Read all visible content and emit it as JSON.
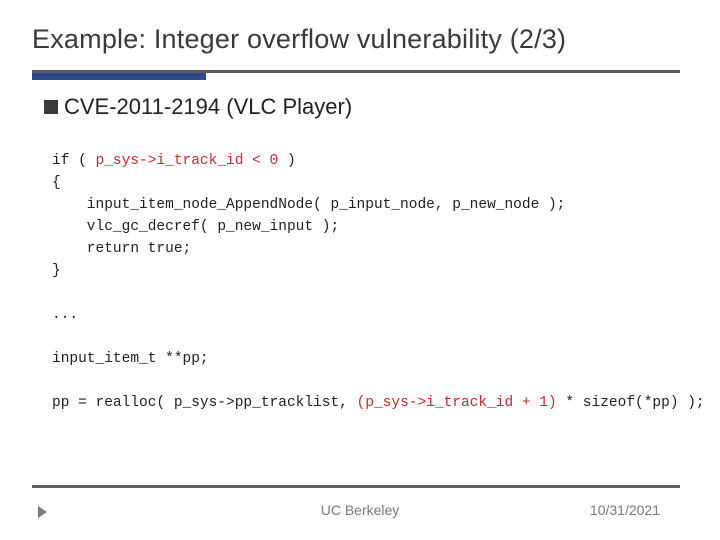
{
  "title": "Example: Integer overflow vulnerability (2/3)",
  "cve_bullet": "CVE-2011-2194 (VLC Player)",
  "code": {
    "l1a": "if ( ",
    "l1b": "p_sys->i_track_id < 0",
    "l1c": " )",
    "l2": "{",
    "l3": "    input_item_node_AppendNode( p_input_node, p_new_node );",
    "l4": "    vlc_gc_decref( p_new_input );",
    "l5": "    return true;",
    "l6": "}",
    "l7": "...",
    "l8": "input_item_t **pp;",
    "l9a": "pp = realloc( p_sys->pp_tracklist, ",
    "l9b": "(p_sys->i_track_id + 1)",
    "l9c": " * sizeof(*pp) );"
  },
  "footer": {
    "center": "UC Berkeley",
    "date": "10/31/2021"
  }
}
